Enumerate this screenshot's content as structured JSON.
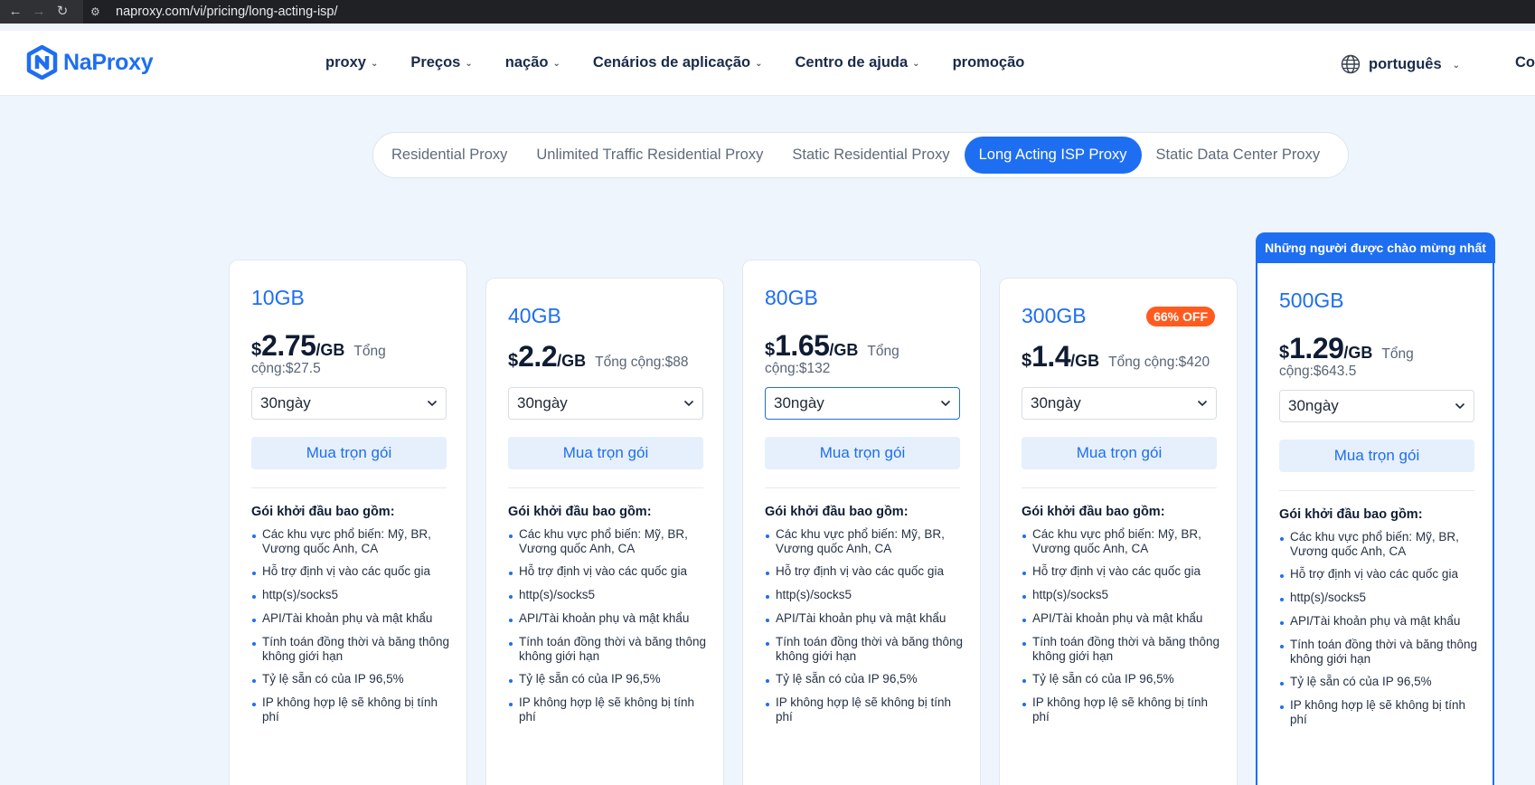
{
  "browser": {
    "url": "naproxy.com/vi/pricing/long-acting-isp/",
    "back_icon": "arrow-left-icon",
    "forward_icon": "arrow-right-icon",
    "reload_icon": "reload-icon"
  },
  "header": {
    "logo_text": "NaProxy",
    "nav": [
      {
        "label": "proxy"
      },
      {
        "label": "Preços"
      },
      {
        "label": "nação"
      },
      {
        "label": "Cenários de aplicação"
      },
      {
        "label": "Centro de ajuda"
      },
      {
        "label": "promoção"
      }
    ],
    "language": "português",
    "cut_text": "Co"
  },
  "tabs": [
    {
      "label": "Residential Proxy",
      "active": false
    },
    {
      "label": "Unlimited Traffic Residential Proxy",
      "active": false
    },
    {
      "label": "Static Residential Proxy",
      "active": false
    },
    {
      "label": "Long Acting ISP Proxy",
      "active": true
    },
    {
      "label": "Static Data Center Proxy",
      "active": false
    }
  ],
  "featured_banner": "Những người được chào mừng nhất",
  "currency": "$",
  "unit": "/GB",
  "plans": [
    {
      "size": "10GB",
      "price": "2.75",
      "total_label": "Tổng",
      "total_value": "cộng:$27.5",
      "duration": "30ngày",
      "buy": "Mua trọn gói",
      "badge": ""
    },
    {
      "size": "40GB",
      "price": "2.2",
      "total_label": "Tổng cộng:$88",
      "total_value": "",
      "duration": "30ngày",
      "buy": "Mua trọn gói",
      "badge": ""
    },
    {
      "size": "80GB",
      "price": "1.65",
      "total_label": "Tổng",
      "total_value": "cộng:$132",
      "duration": "30ngày",
      "buy": "Mua trọn gói",
      "badge": ""
    },
    {
      "size": "300GB",
      "price": "1.4",
      "total_label": "Tổng cộng:$420",
      "total_value": "",
      "duration": "30ngày",
      "buy": "Mua trọn gói",
      "badge": "66% OFF"
    },
    {
      "size": "500GB",
      "price": "1.29",
      "total_label": "Tổng",
      "total_value": "cộng:$643.5",
      "duration": "30ngày",
      "buy": "Mua trọn gói",
      "badge": ""
    }
  ],
  "features_title": "Gói khởi đầu bao gồm:",
  "features": [
    "Các khu vực phổ biến: Mỹ, BR, Vương quốc Anh, CA",
    "Hỗ trợ định vị vào các quốc gia",
    "http(s)/socks5",
    "API/Tài khoản phụ và mật khẩu",
    "Tính toán đồng thời và băng thông không giới hạn",
    "Tỷ lệ sẵn có của IP 96,5%",
    "IP không hợp lệ sẽ không bị tính phí"
  ]
}
